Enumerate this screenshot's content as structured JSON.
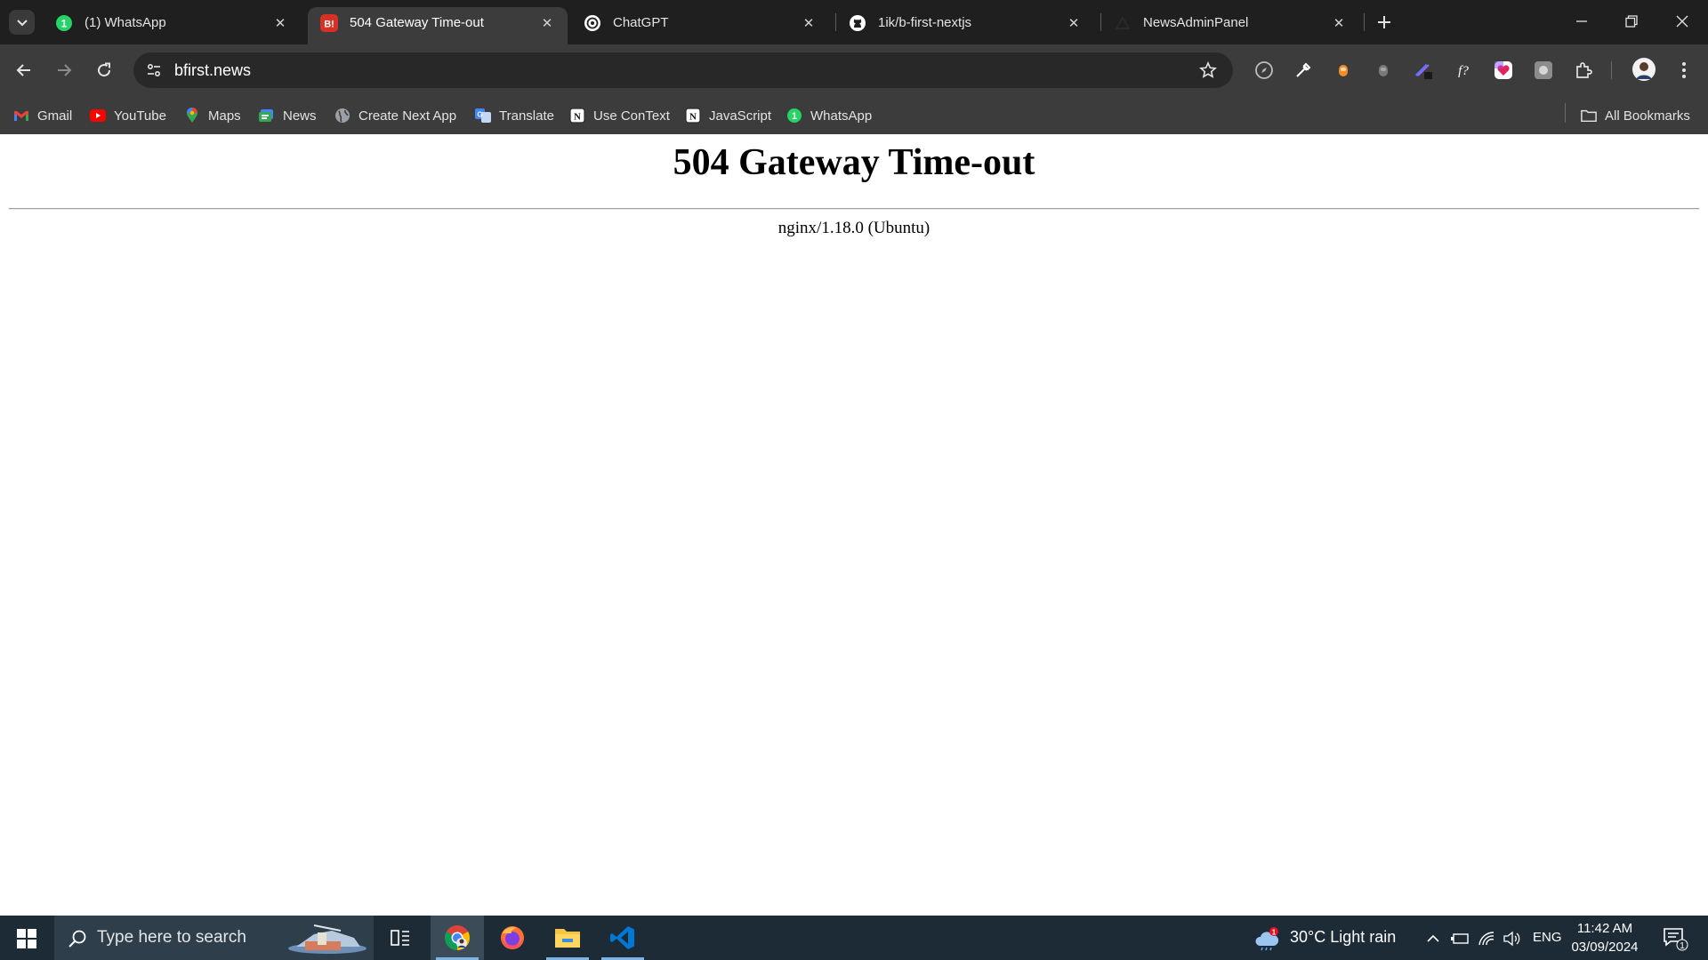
{
  "browser": {
    "tabs": [
      {
        "title": "(1) WhatsApp",
        "icon": "whatsapp-icon",
        "active": false
      },
      {
        "title": "504 Gateway Time-out",
        "icon": "bfirst-icon",
        "active": true
      },
      {
        "title": "ChatGPT",
        "icon": "chatgpt-icon",
        "active": false
      },
      {
        "title": "1ik/b-first-nextjs",
        "icon": "github-icon",
        "active": false
      },
      {
        "title": "NewsAdminPanel",
        "icon": "triangle-icon",
        "active": false
      }
    ],
    "whatsapp_badge": "1",
    "favicon_bfirst_text": "B!",
    "address": "bfirst.news"
  },
  "bookmarks": [
    {
      "label": "Gmail",
      "icon": "gmail-icon"
    },
    {
      "label": "YouTube",
      "icon": "youtube-icon"
    },
    {
      "label": "Maps",
      "icon": "maps-icon"
    },
    {
      "label": "News",
      "icon": "news-icon"
    },
    {
      "label": "Create Next App",
      "icon": "globe-icon"
    },
    {
      "label": "Translate",
      "icon": "translate-icon"
    },
    {
      "label": "Use ConText",
      "icon": "notion-icon"
    },
    {
      "label": "JavaScript",
      "icon": "notion-icon"
    },
    {
      "label": "WhatsApp",
      "icon": "whatsapp-icon"
    }
  ],
  "all_bookmarks_label": "All Bookmarks",
  "page": {
    "heading": "504 Gateway Time-out",
    "server": "nginx/1.18.0 (Ubuntu)"
  },
  "taskbar": {
    "search_placeholder": "Type here to search",
    "weather": "30°C  Light rain",
    "weather_badge": "1",
    "language": "ENG",
    "time": "11:42 AM",
    "date": "03/09/2024",
    "notification_count": "1"
  },
  "colors": {
    "tab_strip": "#1f1f1f",
    "toolbar": "#3c3c3c",
    "taskbar": "#1d2b37",
    "whatsapp_green": "#25d366",
    "bfirst_red": "#d93025",
    "youtube_red": "#ff0000"
  }
}
